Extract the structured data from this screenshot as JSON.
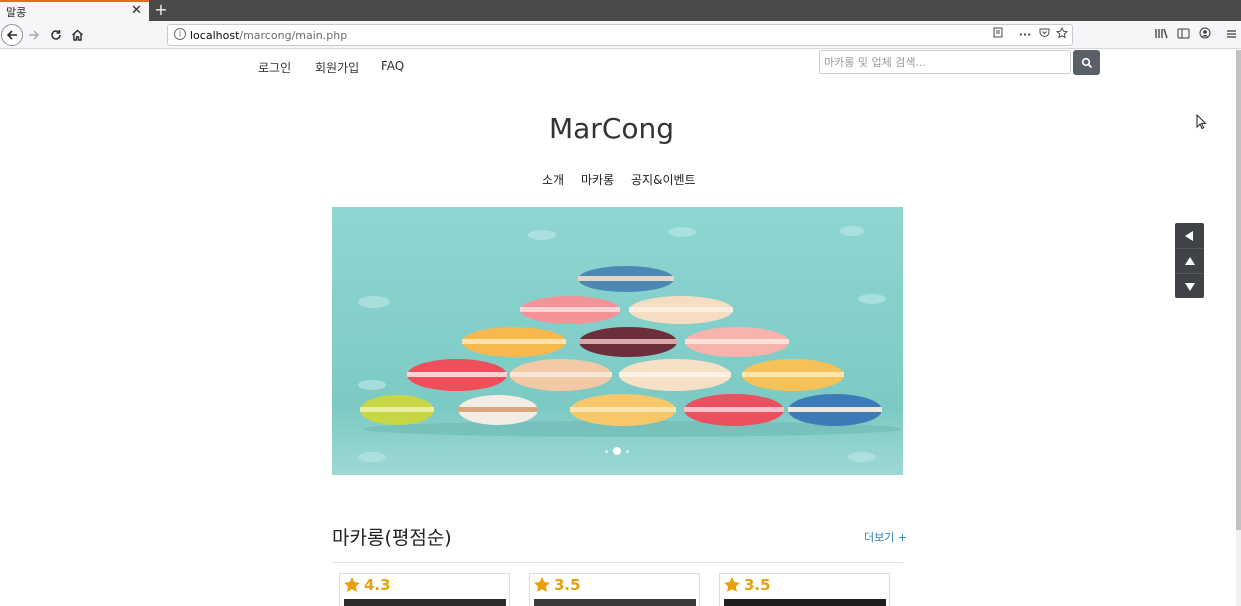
{
  "browser": {
    "tab_title": "말콩",
    "tab_close": "✕",
    "new_tab": "+",
    "url_host": "localhost",
    "url_path": "/marcong/main.php"
  },
  "header": {
    "links": [
      "로그인",
      "회원가입",
      "FAQ"
    ],
    "search_placeholder": "마카롱 및 업체 검색..."
  },
  "site": {
    "title": "MarCong",
    "menu": [
      "소개",
      "마카롱",
      "공지&이벤트"
    ]
  },
  "carousel": {
    "slide_count": 3,
    "active_index": 1
  },
  "section": {
    "title": "마카롱(평점순)",
    "more_label": "더보기 +"
  },
  "cards": [
    {
      "rating": "4.3"
    },
    {
      "rating": "3.5"
    },
    {
      "rating": "3.5"
    }
  ],
  "colors": {
    "accent_link": "#2a7fc0",
    "star": "#e8a20e",
    "hero_bg": "#86d0cc",
    "side_ctrl": "#3f4348"
  }
}
